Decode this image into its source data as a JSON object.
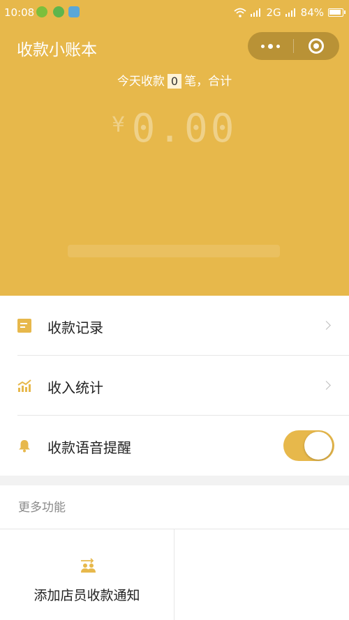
{
  "status_bar": {
    "time": "10:08",
    "network": "2G",
    "battery": "84%"
  },
  "header": {
    "title": "收款小账本",
    "summary_prefix": "今天收款",
    "count": "0",
    "summary_suffix": "笔，合计",
    "currency": "¥",
    "amount": "0.00",
    "background_color": "#e7b84b"
  },
  "menu": {
    "items": [
      {
        "label": "收款记录",
        "icon": "document-icon"
      },
      {
        "label": "收入统计",
        "icon": "chart-icon"
      },
      {
        "label": "收款语音提醒",
        "icon": "bell-icon",
        "toggle_on": true
      }
    ]
  },
  "more": {
    "title": "更多功能",
    "items": [
      {
        "label": "添加店员收款通知",
        "icon": "add-staff-icon"
      }
    ]
  }
}
